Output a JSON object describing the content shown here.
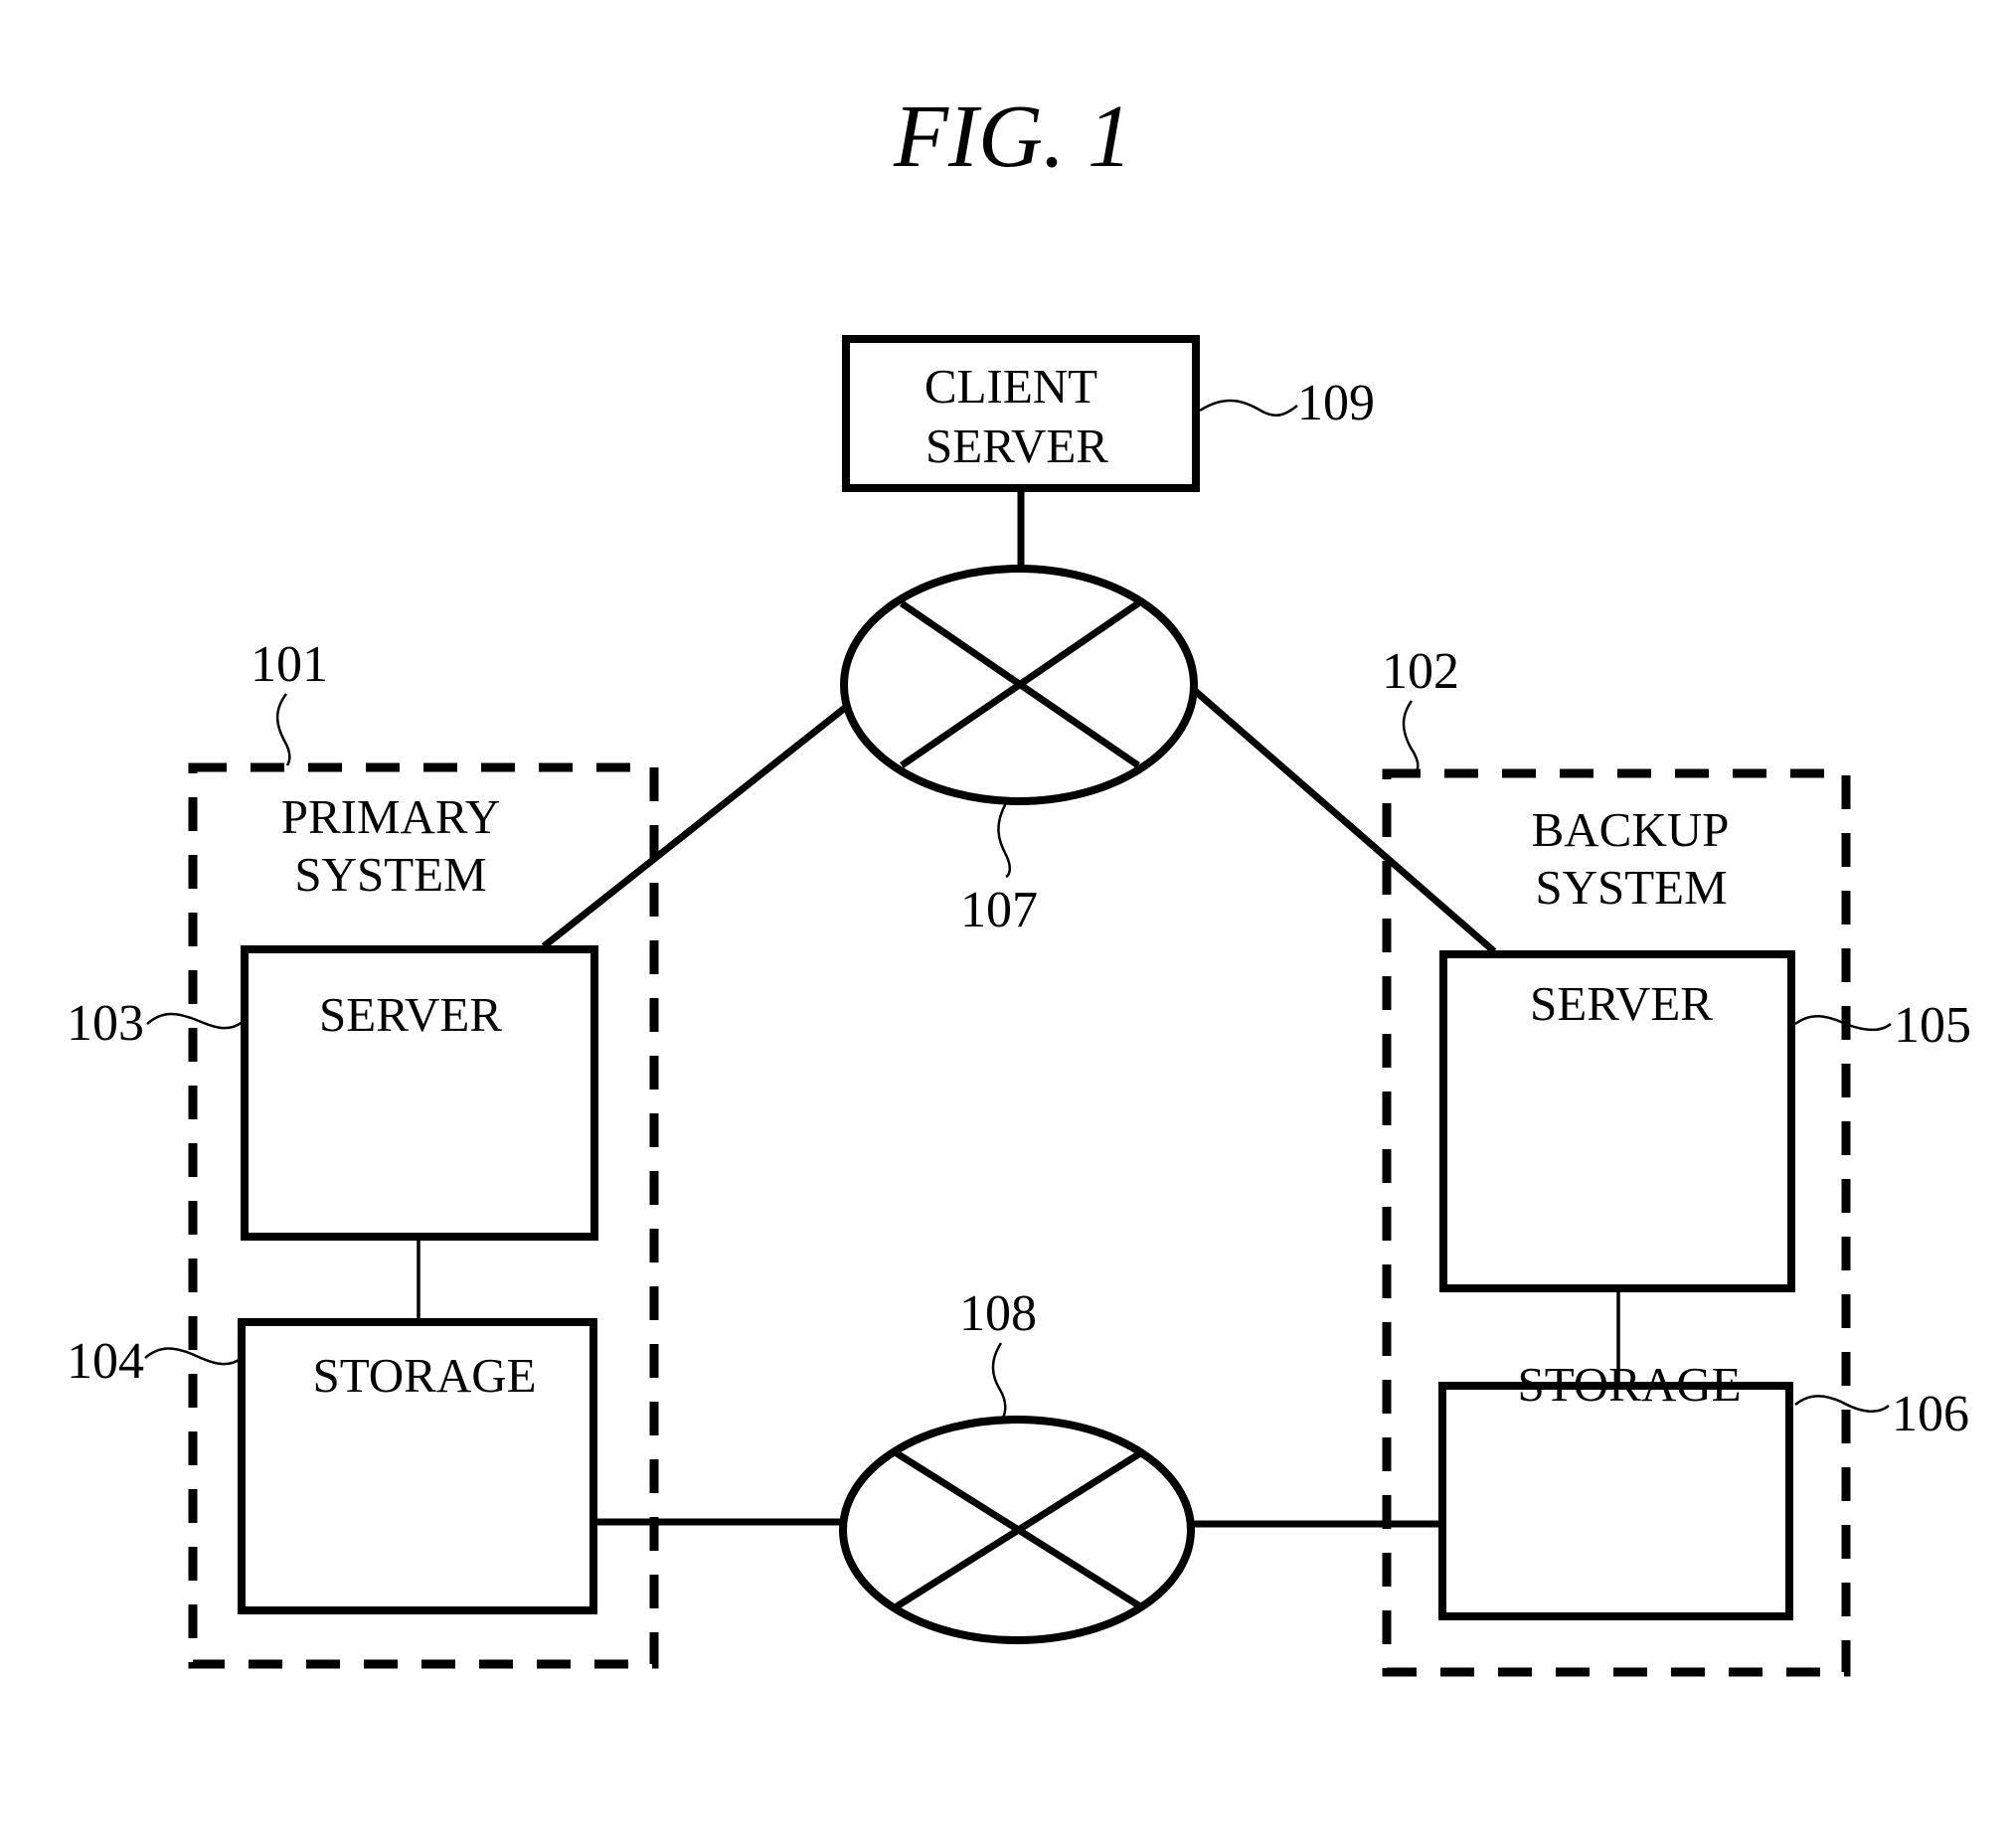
{
  "figure": {
    "title": "FIG.  1",
    "type": "system block diagram"
  },
  "nodes": {
    "client_server": {
      "ref": "109",
      "lines": [
        "CLIENT",
        "SERVER"
      ]
    },
    "network_top": {
      "ref": "107",
      "symbol": "network-cross-ellipse"
    },
    "network_bottom": {
      "ref": "108",
      "symbol": "network-cross-ellipse"
    },
    "primary_system": {
      "ref": "101",
      "lines": [
        "PRIMARY",
        "SYSTEM"
      ],
      "server": {
        "ref": "103",
        "label": "SERVER"
      },
      "storage": {
        "ref": "104",
        "label": "STORAGE"
      }
    },
    "backup_system": {
      "ref": "102",
      "lines": [
        "BACKUP",
        "SYSTEM"
      ],
      "server": {
        "ref": "105",
        "label": "SERVER"
      },
      "storage": {
        "ref": "106",
        "label": "STORAGE"
      }
    }
  },
  "connections": [
    {
      "from": "client_server",
      "to": "network_top"
    },
    {
      "from": "network_top",
      "to": "primary_system.server"
    },
    {
      "from": "network_top",
      "to": "backup_system.server"
    },
    {
      "from": "primary_system.server",
      "to": "primary_system.storage"
    },
    {
      "from": "backup_system.server",
      "to": "backup_system.storage"
    },
    {
      "from": "primary_system.storage",
      "to": "network_bottom"
    },
    {
      "from": "network_bottom",
      "to": "backup_system.storage"
    }
  ]
}
